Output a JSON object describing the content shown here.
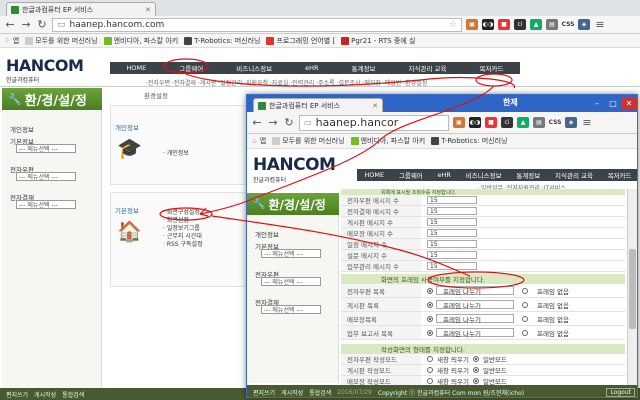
{
  "back_window": {
    "tab_title": "한글과컴퓨터 EP 서비스",
    "url": "haanep.hancom.com",
    "bookmarks": [
      "앱",
      "모두를 위한 머신러닝",
      "엔비디아, 파스칼 아키",
      "T-Robotics: 머신러닝",
      "프로그래밍 언어별 [",
      "Pgr21 - RTS 중에 실"
    ],
    "logo_text": "HANCOM",
    "logo_sub": "한글과컴퓨터",
    "nav": [
      "HOME",
      "그룹웨어",
      "비즈니스정보",
      "eHR",
      "통계정보",
      "지식관리 교육",
      "목저카드"
    ],
    "subnav": "·전자우편 ·전자결재 ·게시판 ·일정관리 ·지원요청 ·자료실 ·인력관리 ·주소록 ·설문조사 ·메모장 ·메일반 ·환경설정",
    "breadcrumb": "환경설정",
    "side_title": "환/경/설/정",
    "side_sections": [
      {
        "label": "개인정보",
        "menu": ""
      },
      {
        "label": "기본정보",
        "menu": "--- 메뉴선택 ---"
      },
      {
        "label": "전자우편",
        "menu": "--- 메뉴선택 ---"
      },
      {
        "label": "전자결재",
        "menu": "--- 메뉴선택 ---"
      }
    ],
    "panel1_title": "개인정보",
    "panel1_item": "· 개인정보",
    "panel2_title": "기본정보",
    "panel2_items": [
      "· 화면구성설정",
      "· 화면선정",
      "· 일정보기그룹",
      "· 근무지 시간대",
      "· RSS 구독설정"
    ],
    "status_items": [
      "편지쓰기",
      "게시작성",
      "통합검색"
    ]
  },
  "front_window": {
    "corner_label": "한제",
    "tab_title": "한글과컴퓨터 EP 서비스",
    "url": "haanep.hancor",
    "bookmarks": [
      "앱",
      "모두를 위한 머신러닝",
      "엔비디아, 파스칼 아키",
      "T-Robotics: 머신러닝"
    ],
    "logo_text": "HANCOM",
    "logo_sub": "한글과컴퓨터",
    "nav": [
      "HOME",
      "그룹웨어",
      "eHR",
      "비즈니스정보",
      "통계정보",
      "지식관리 교육",
      "목저카드"
    ],
    "subnav": "·일반업무 ·전자자원관리 ·IT서비스",
    "side_title": "환/경/설/정",
    "side_sections": [
      {
        "label": "개인정보",
        "menu": ""
      },
      {
        "label": "기본정보",
        "menu": "--- 메뉴선택 ---"
      },
      {
        "label": "전자우편",
        "menu": "--- 메뉴선택 ---"
      },
      {
        "label": "전자결재",
        "menu": "--- 메뉴선택 ---"
      }
    ],
    "top_header": "목록에 표시될 조회수를 지정합니다.",
    "list_rows": [
      {
        "label": "전자우편 메시지 수",
        "value": "15"
      },
      {
        "label": "전자결재 메시지 수",
        "value": "15"
      },
      {
        "label": "게시판 메시지 수",
        "value": "15"
      },
      {
        "label": "메모장 메시지 수",
        "value": "15"
      },
      {
        "label": "일정 메시지 수",
        "value": "15"
      },
      {
        "label": "설문 메시지 수",
        "value": "15"
      },
      {
        "label": "업무관리 메시지 수",
        "value": "15"
      }
    ],
    "frame_header": "화면의 프레임 사용여부를 지정합니다.",
    "frame_rows": [
      {
        "label": "전자우편 목록"
      },
      {
        "label": "게시판 목록"
      },
      {
        "label": "메모장목록"
      },
      {
        "label": "업무 보고서 목록"
      }
    ],
    "frame_split": "프레임 나누기",
    "frame_none": "프레임 없음",
    "mode_header": "작성화면의 형태를 지정합니다.",
    "mode_rows": [
      {
        "label": "전자우편 작성모드"
      },
      {
        "label": "게시판 작성모드"
      },
      {
        "label": "메모장 작성모드"
      }
    ],
    "mode_new": "새창 띄우기",
    "mode_normal": "일반모드",
    "status_items": [
      "편지쓰기",
      "게시작성",
      "통합검색"
    ],
    "status_copyright": "Copyright ⓒ 한글과컴퓨터 Com mon 원/조현채(icho)",
    "logout": "Logout",
    "date": "2016/07/29"
  }
}
